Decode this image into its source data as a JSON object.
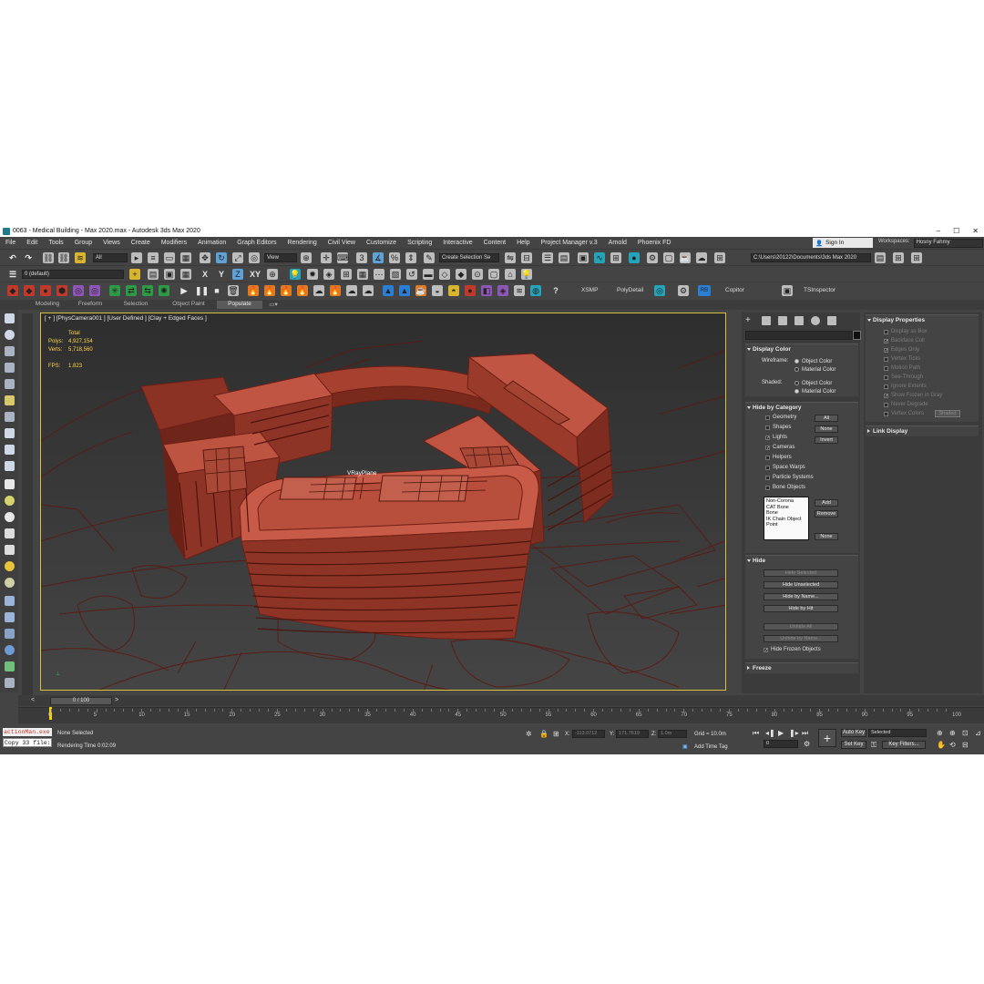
{
  "window": {
    "title": "0063 - Medical Building - Max 2020.max - Autodesk 3ds Max 2020",
    "controls": [
      "–",
      "☐",
      "✕"
    ]
  },
  "menu": [
    "File",
    "Edit",
    "Tools",
    "Group",
    "Views",
    "Create",
    "Modifiers",
    "Animation",
    "Graph Editors",
    "Rendering",
    "Civil View",
    "Customize",
    "Scripting",
    "Interactive",
    "Content",
    "Help",
    "Project Manager v.3",
    "Arnold",
    "Phoenix FD"
  ],
  "account": {
    "signin": "Sign In",
    "workspaces_label": "Workspaces:",
    "workspace": "Hosny Fahmy"
  },
  "toolbar1": {
    "filter": "All",
    "view": "View",
    "selection_set": "Create Selection Se",
    "path": "C:\\Users\\20122\\Documents\\3ds Max 2020"
  },
  "toolbar2": {
    "layer": "0 (default)",
    "axis_x": "X",
    "axis_y": "Y",
    "axis_z": "Z",
    "axis_xy": "XY"
  },
  "toolbar3": {
    "labels": [
      "XSMP",
      "PolyDetail",
      "RB",
      "Copitor",
      "TSInspector"
    ]
  },
  "ribbon": {
    "tabs": [
      "Modeling",
      "Freeform",
      "Selection",
      "Object Paint",
      "Populate"
    ],
    "active": "Populate"
  },
  "viewport": {
    "label": "[ + ] [PhysCamera001 ] [User Defined ] [Clay + Edged Faces ]",
    "stats": {
      "total": "Total",
      "polys_label": "Polys:",
      "polys": "4,927,154",
      "verts_label": "Verts:",
      "verts": "5,718,560",
      "fps_label": "FPS:",
      "fps": "1.823"
    },
    "object_label": "VRayPlane",
    "colors": {
      "building": "#b54a3a",
      "edge": "#6e1f16",
      "ground": "#3c3c3c",
      "frame": "#d9c23b"
    }
  },
  "display_panel": {
    "display_color": {
      "title": "Display Color",
      "wireframe_label": "Wireframe:",
      "shaded_label": "Shaded:",
      "object_color": "Object Color",
      "material_color": "Material Color"
    },
    "hide_by_category": {
      "title": "Hide by Category",
      "items": [
        {
          "label": "Geometry",
          "checked": false
        },
        {
          "label": "Shapes",
          "checked": false
        },
        {
          "label": "Lights",
          "checked": true
        },
        {
          "label": "Cameras",
          "checked": true
        },
        {
          "label": "Helpers",
          "checked": false
        },
        {
          "label": "Space Warps",
          "checked": false
        },
        {
          "label": "Particle Systems",
          "checked": false
        },
        {
          "label": "Bone Objects",
          "checked": false
        }
      ],
      "all_btn": "All",
      "none_btn": "None",
      "invert_btn": "Invert",
      "list": [
        "Non-Corona",
        "CAT Bone",
        "Bone",
        "IK Chain Object",
        "Point"
      ],
      "add_btn": "Add",
      "remove_btn": "Remove",
      "none_btn2": "None"
    },
    "hide": {
      "title": "Hide",
      "hide_selected": "Hide Selected",
      "hide_unselected": "Hide Unselected",
      "hide_by_name": "Hide by Name...",
      "hide_by_hit": "Hide by Hit",
      "unhide_all": "Unhide All",
      "unhide_by_name": "Unhide by Name...",
      "hide_frozen": "Hide Frozen Objects"
    },
    "freeze": {
      "title": "Freeze"
    }
  },
  "display_properties": {
    "title": "Display Properties",
    "items": [
      {
        "label": "Display as Box",
        "checked": false
      },
      {
        "label": "Backface Cull",
        "checked": true
      },
      {
        "label": "Edges Only",
        "checked": true
      },
      {
        "label": "Vertex Ticks",
        "checked": false
      },
      {
        "label": "Motion Path",
        "checked": false
      },
      {
        "label": "See-Through",
        "checked": false
      },
      {
        "label": "Ignore Extents",
        "checked": false
      },
      {
        "label": "Show Frozen in Gray",
        "checked": true
      },
      {
        "label": "Never Degrade",
        "checked": false
      },
      {
        "label": "Vertex Colors",
        "checked": false
      }
    ],
    "shaded_btn": "Shaded",
    "link_display": "Link Display"
  },
  "timeline": {
    "frame": "0 / 100",
    "ticks": [
      "0",
      "5",
      "10",
      "15",
      "20",
      "25",
      "30",
      "35",
      "40",
      "45",
      "50",
      "55",
      "60",
      "65",
      "70",
      "75",
      "80",
      "85",
      "90",
      "95",
      "100"
    ]
  },
  "status": {
    "maxscript_1": "actionMan.exe",
    "maxscript_2": "Copy 33 file:",
    "selection": "None Selected",
    "render_time": "Rendering Time  0:02:09",
    "x_label": "X:",
    "x": "-113.0712",
    "y_label": "Y:",
    "y": "171.7619",
    "z_label": "Z:",
    "z": "1.0m",
    "grid": "Grid = 10.0m",
    "add_time_tag": "Add Time Tag",
    "auto_key": "Auto Key",
    "selected": "Selected",
    "set_key": "Set Key",
    "key_filters": "Key Filters...",
    "frame_field": "0"
  }
}
